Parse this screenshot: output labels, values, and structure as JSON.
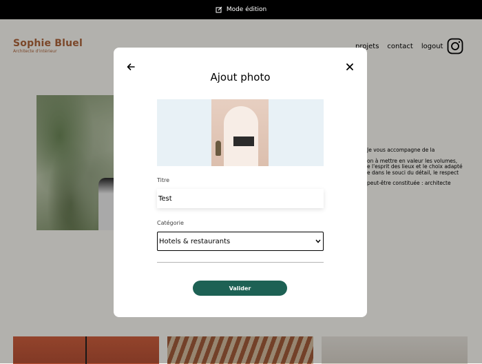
{
  "editbar": {
    "label": "Mode édition",
    "icon": "edit-icon"
  },
  "header": {
    "brand_name": "Sophie Bluel",
    "brand_subtitle": "Architecte d'intérieur",
    "nav": [
      "projets",
      "contact",
      "logout"
    ],
    "instagram_icon": "instagram-icon",
    "brand_color": "#b1663c"
  },
  "about": {
    "lines": [
      "Je vous accompagne de la",
      "on à mettre en valeur les volumes,\ne l'esprit des lieux et le choix adapté\ne dans le souci du détail, le respect",
      "peut-être constituée : architecte"
    ]
  },
  "modal": {
    "title": "Ajout photo",
    "back_icon": "arrow-left-icon",
    "close_icon": "close-icon",
    "title_label": "Titre",
    "title_value": "Test",
    "category_label": "Catégorie",
    "category_value": "Hotels & restaurants",
    "submit_label": "Valider",
    "accent_color": "#1d6154"
  }
}
